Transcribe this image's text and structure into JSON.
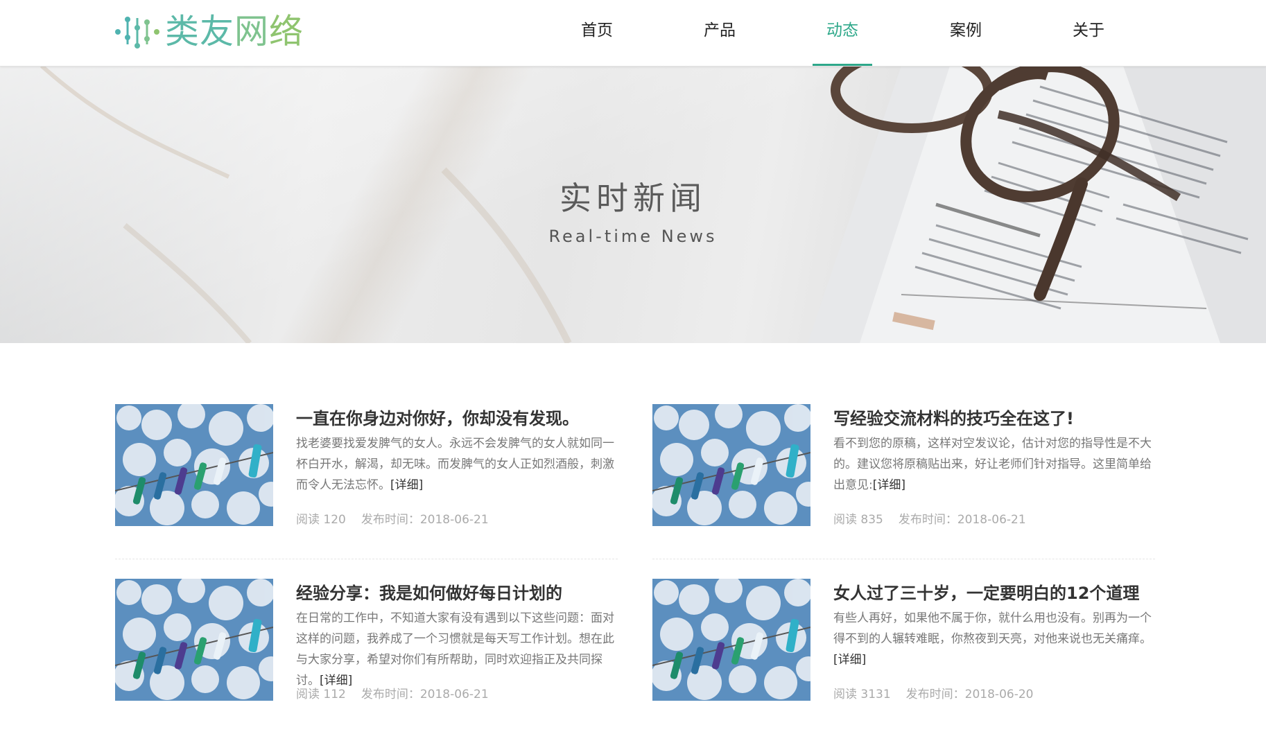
{
  "header": {
    "logo_text_1": "类友",
    "logo_text_2": "网",
    "logo_text_3": "络",
    "nav": [
      {
        "label": "首页"
      },
      {
        "label": "产品"
      },
      {
        "label": "动态",
        "active": true
      },
      {
        "label": "案例"
      },
      {
        "label": "关于"
      }
    ]
  },
  "banner": {
    "title": "实时新闻",
    "subtitle": "Real-time News"
  },
  "news": [
    {
      "title": "一直在你身边对你好，你却没有发现。",
      "summary": "找老婆要找爱发脾气的女人。永远不会发脾气的女人就如同一杯白开水，解渴，却无味。而发脾气的女人正如烈酒般，刺激而令人无法忘怀。",
      "more": "[详细]",
      "reads": "阅读 120",
      "date": "发布时间：2018-06-21"
    },
    {
      "title": "写经验交流材料的技巧全在这了!",
      "summary": "看不到您的原稿，这样对空发议论，估计对您的指导性是不大的。建议您将原稿贴出来，好让老师们针对指导。这里简单给出意见:",
      "more": "[详细]",
      "reads": "阅读 835",
      "date": "发布时间：2018-06-21"
    },
    {
      "title": "经验分享：我是如何做好每日计划的",
      "summary": "在日常的工作中，不知道大家有没有遇到以下这些问题：面对这样的问题，我养成了一个习惯就是每天写工作计划。想在此与大家分享，希望对你们有所帮助，同时欢迎指正及共同探讨。",
      "more": "[详细]",
      "reads": "阅读 112",
      "date": "发布时间：2018-06-21"
    },
    {
      "title": "女人过了三十岁，一定要明白的12个道理",
      "summary": "有些人再好，如果他不属于你，就什么用也没有。别再为一个得不到的人辗转难眠，你熬夜到天亮，对他来说也无关痛痒。",
      "more": "[详细]",
      "reads": "阅读 3131",
      "date": "发布时间：2018-06-20"
    }
  ],
  "colors": {
    "accent": "#2ea88a",
    "logo_teal": "#5cb9a8",
    "logo_green": "#8fc46f"
  }
}
